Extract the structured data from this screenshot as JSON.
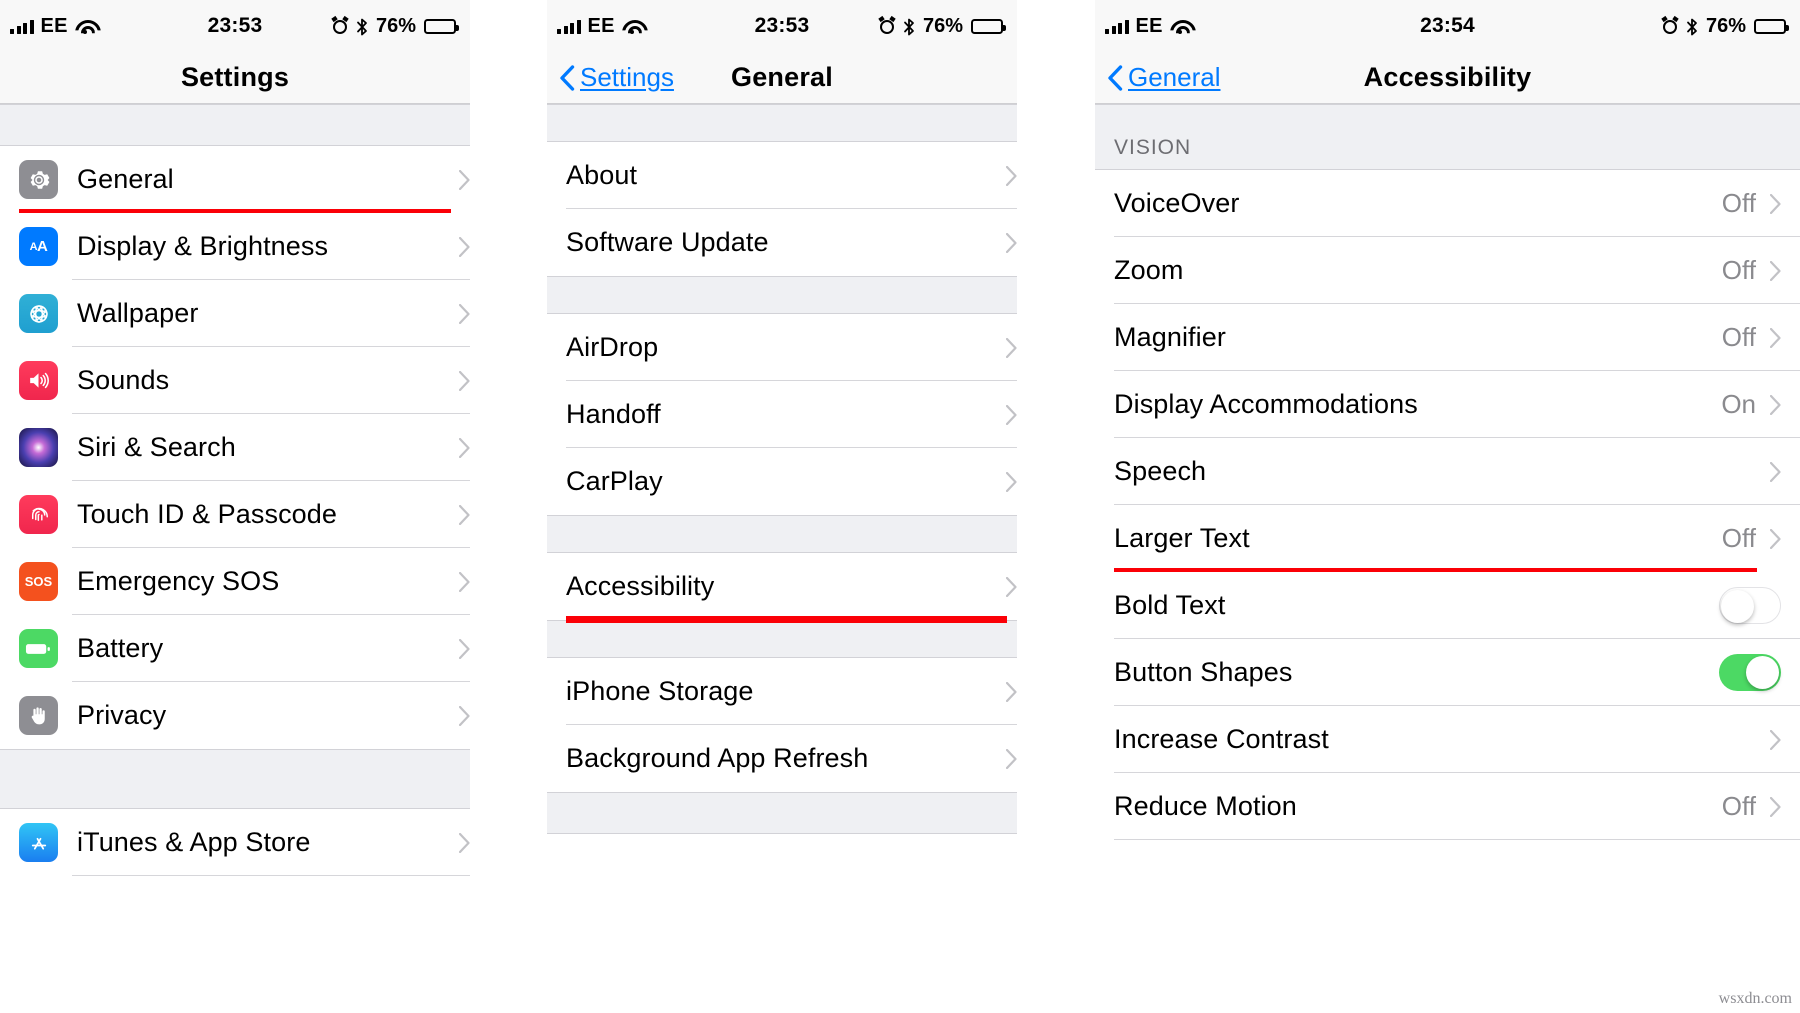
{
  "panels": [
    {
      "id": "settings",
      "status": {
        "carrier": "EE",
        "time": "23:53",
        "battery_pct": "76%"
      },
      "nav": {
        "title": "Settings",
        "back_label": null
      },
      "rows": [
        {
          "label": "General",
          "icon": "gear-icon",
          "highlighted": true
        },
        {
          "label": "Display & Brightness",
          "icon": "aa-icon",
          "highlighted": false
        },
        {
          "label": "Wallpaper",
          "icon": "wallpaper-icon",
          "highlighted": false
        },
        {
          "label": "Sounds",
          "icon": "speaker-icon",
          "highlighted": false
        },
        {
          "label": "Siri & Search",
          "icon": "siri-icon",
          "highlighted": false
        },
        {
          "label": "Touch ID & Passcode",
          "icon": "fingerprint-icon",
          "highlighted": false
        },
        {
          "label": "Emergency SOS",
          "icon": "sos-icon",
          "highlighted": false
        },
        {
          "label": "Battery",
          "icon": "battery-icon",
          "highlighted": false
        },
        {
          "label": "Privacy",
          "icon": "hand-icon",
          "highlighted": false
        },
        {
          "label": "iTunes & App Store",
          "icon": "appstore-icon",
          "highlighted": false
        }
      ]
    },
    {
      "id": "general",
      "status": {
        "carrier": "EE",
        "time": "23:53",
        "battery_pct": "76%"
      },
      "nav": {
        "title": "General",
        "back_label": "Settings"
      },
      "rows": [
        {
          "label": "About",
          "highlighted": false
        },
        {
          "label": "Software Update",
          "highlighted": false
        },
        {
          "label": "AirDrop",
          "highlighted": false
        },
        {
          "label": "Handoff",
          "highlighted": false
        },
        {
          "label": "CarPlay",
          "highlighted": false
        },
        {
          "label": "Accessibility",
          "highlighted": true
        },
        {
          "label": "iPhone Storage",
          "highlighted": false
        },
        {
          "label": "Background App Refresh",
          "highlighted": false
        }
      ]
    },
    {
      "id": "accessibility",
      "status": {
        "carrier": "EE",
        "time": "23:54",
        "battery_pct": "76%"
      },
      "nav": {
        "title": "Accessibility",
        "back_label": "General"
      },
      "section_header": "VISION",
      "rows": [
        {
          "label": "VoiceOver",
          "value": "Off",
          "control": "chevron",
          "highlighted": false
        },
        {
          "label": "Zoom",
          "value": "Off",
          "control": "chevron",
          "highlighted": false
        },
        {
          "label": "Magnifier",
          "value": "Off",
          "control": "chevron",
          "highlighted": false
        },
        {
          "label": "Display Accommodations",
          "value": "On",
          "control": "chevron",
          "highlighted": false
        },
        {
          "label": "Speech",
          "value": "",
          "control": "chevron",
          "highlighted": false
        },
        {
          "label": "Larger Text",
          "value": "Off",
          "control": "chevron",
          "highlighted": true
        },
        {
          "label": "Bold Text",
          "value": "",
          "control": "toggle-off",
          "highlighted": false
        },
        {
          "label": "Button Shapes",
          "value": "",
          "control": "toggle-on",
          "highlighted": false
        },
        {
          "label": "Increase Contrast",
          "value": "",
          "control": "chevron",
          "highlighted": false
        },
        {
          "label": "Reduce Motion",
          "value": "Off",
          "control": "chevron",
          "highlighted": false
        }
      ]
    }
  ],
  "colors": {
    "accent_blue": "#007aff",
    "highlight_red": "#fb0007",
    "toggle_on_green": "#4cd964",
    "value_gray": "#8a8a8e"
  },
  "watermark": "wsxdn.com"
}
